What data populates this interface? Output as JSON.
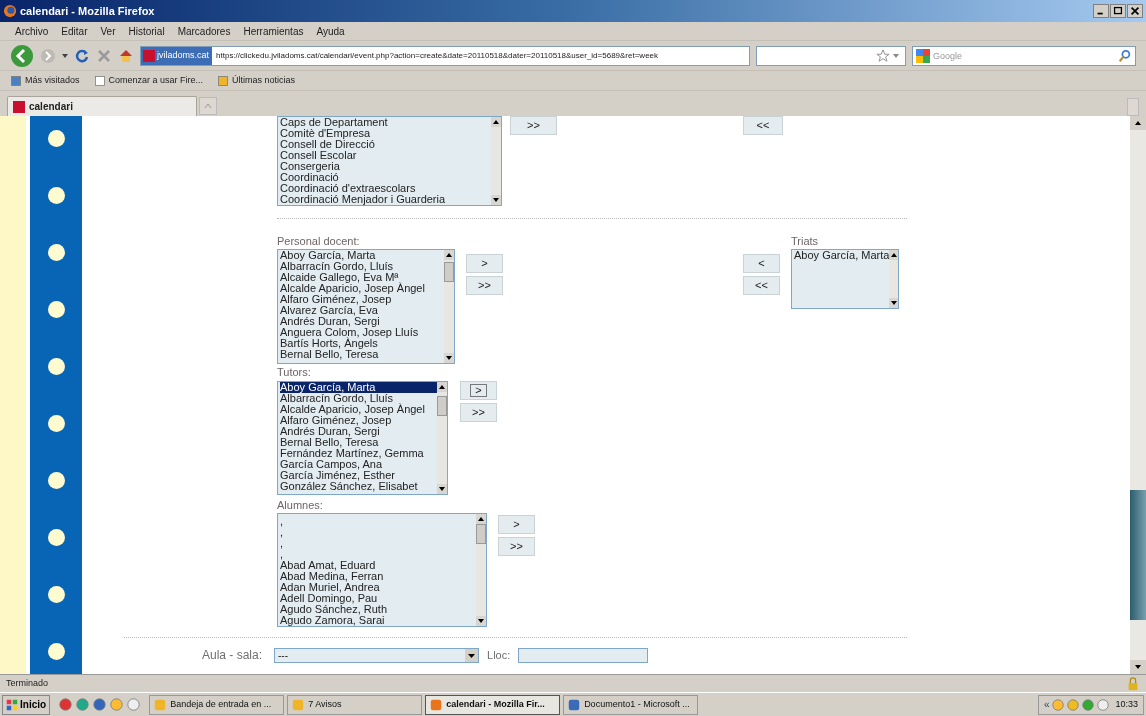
{
  "window": {
    "title": "calendari - Mozilla Firefox"
  },
  "menu": [
    "Archivo",
    "Editar",
    "Ver",
    "Historial",
    "Marcadores",
    "Herramientas",
    "Ayuda"
  ],
  "nav": {
    "site_badge": "jviladoms.cat",
    "url": "https://clickedu.jviladoms.cat/calendari/event.php?action=create&date=20110518&dater=20110518&user_id=5689&ret=week",
    "search_placeholder": "Google"
  },
  "bookmarks": [
    "Más visitados",
    "Comenzar a usar Fire...",
    "Últimas noticias"
  ],
  "tabs": [
    {
      "label": "calendari",
      "selected": true
    }
  ],
  "form": {
    "groups": {
      "items": [
        {
          "text": "Caps de Departament",
          "selected": false
        },
        {
          "text": "Comitè d'Empresa",
          "selected": false
        },
        {
          "text": "Consell de Direcció",
          "selected": false
        },
        {
          "text": "Consell Escolar",
          "selected": false
        },
        {
          "text": "Consergeria",
          "selected": false
        },
        {
          "text": "Coordinació",
          "selected": false
        },
        {
          "text": "Coordinació d'extraescolars",
          "selected": false
        },
        {
          "text": "Coordinació Menjador i Guarderia",
          "selected": false
        }
      ],
      "add_buttons": [
        {
          "label": ">>",
          "focused": false
        }
      ],
      "remove_buttons": [
        {
          "label": "<<",
          "focused": false
        }
      ]
    },
    "staff": {
      "label": "Personal docent:",
      "items": [
        {
          "text": "Aboy García, Marta",
          "selected": false
        },
        {
          "text": "Albarracín Gordo, Lluís",
          "selected": false
        },
        {
          "text": "Alcaide Gallego, Eva Mª",
          "selected": false
        },
        {
          "text": "Alcalde Aparicio, Josep Àngel",
          "selected": false
        },
        {
          "text": "Alfaro Giménez, Josep",
          "selected": false
        },
        {
          "text": "Alvarez García, Eva",
          "selected": false
        },
        {
          "text": "Andrés Duran, Sergi",
          "selected": false
        },
        {
          "text": "Anguera Colom, Josep Lluís",
          "selected": false
        },
        {
          "text": "Bartís Horts, Àngels",
          "selected": false
        },
        {
          "text": "Bernal Bello, Teresa",
          "selected": false
        }
      ],
      "add_buttons": [
        {
          "label": ">",
          "focused": false
        },
        {
          "label": ">>",
          "focused": false
        }
      ],
      "remove_buttons": [
        {
          "label": "<",
          "focused": false
        },
        {
          "label": "<<",
          "focused": false
        }
      ],
      "chosen": {
        "label": "Triats",
        "items": [
          {
            "text": "Aboy García, Marta",
            "selected": false
          }
        ]
      }
    },
    "tutors": {
      "label": "Tutors:",
      "items": [
        {
          "text": "Aboy García, Marta",
          "selected": true
        },
        {
          "text": "Albarracín Gordo, Lluís",
          "selected": false
        },
        {
          "text": "Alcalde Aparicio, Josep Àngel",
          "selected": false
        },
        {
          "text": "Alfaro Giménez, Josep",
          "selected": false
        },
        {
          "text": "Andrés Duran, Sergi",
          "selected": false
        },
        {
          "text": "Bernal Bello, Teresa",
          "selected": false
        },
        {
          "text": "Fernández Martínez, Gemma",
          "selected": false
        },
        {
          "text": "García Campos, Ana",
          "selected": false
        },
        {
          "text": "García Jiménez, Esther",
          "selected": false
        },
        {
          "text": "González Sánchez, Elisabet",
          "selected": false
        }
      ],
      "add_buttons": [
        {
          "label": ">",
          "focused": true
        },
        {
          "label": ">>",
          "focused": false
        }
      ]
    },
    "students": {
      "label": "Alumnes:",
      "items": [
        {
          "text": ",",
          "selected": false
        },
        {
          "text": ",",
          "selected": false
        },
        {
          "text": ",",
          "selected": false
        },
        {
          "text": ",",
          "selected": false
        },
        {
          "text": "Abad Amat, Eduard",
          "selected": false
        },
        {
          "text": "Abad Medina, Ferran",
          "selected": false
        },
        {
          "text": "Adan Muriel, Andrea",
          "selected": false
        },
        {
          "text": "Adell Domingo, Pau",
          "selected": false
        },
        {
          "text": "Agudo Sánchez, Ruth",
          "selected": false
        },
        {
          "text": "Agudo Zamora, Sarai",
          "selected": false
        }
      ],
      "add_buttons": [
        {
          "label": ">",
          "focused": false
        },
        {
          "label": ">>",
          "focused": false
        }
      ]
    },
    "room": {
      "label": "Aula - sala:",
      "value": "---",
      "place_label": "Lloc:"
    }
  },
  "status_bar": "Terminado",
  "taskbar": {
    "start": "Inicio",
    "tasks": [
      {
        "label": "Bandeja de entrada en ...",
        "selected": false
      },
      {
        "label": "7 Avisos",
        "selected": false
      },
      {
        "label": "calendari - Mozilla Fir...",
        "selected": true
      },
      {
        "label": "Documento1 - Microsoft ...",
        "selected": false
      }
    ],
    "tray_toggle": "«",
    "clock": "10:33"
  }
}
